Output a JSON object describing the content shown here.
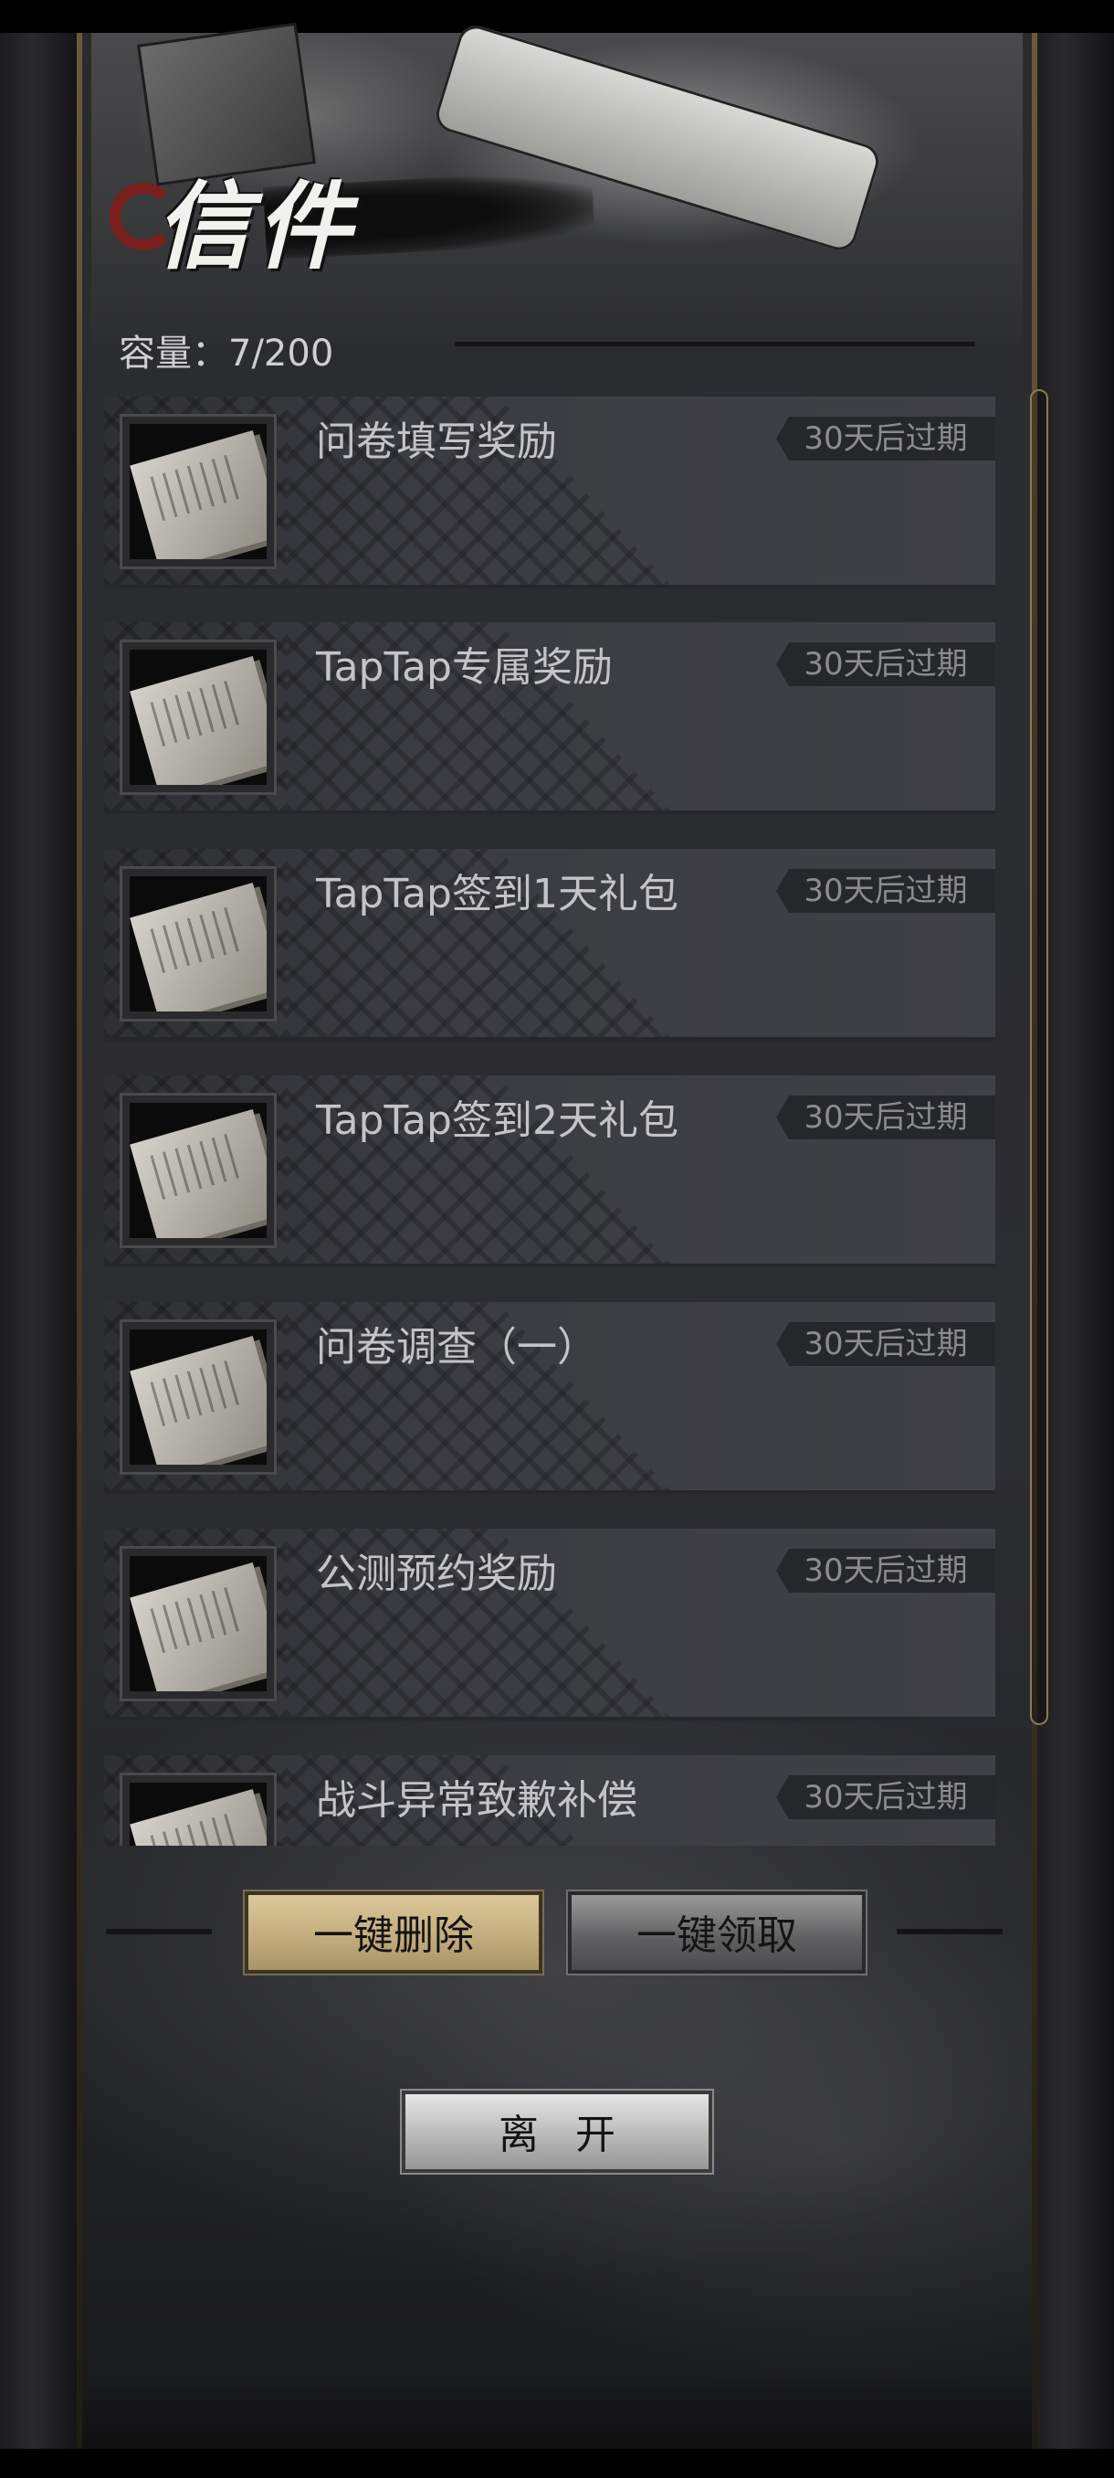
{
  "header": {
    "title": "信件",
    "capacity_label": "容量：",
    "capacity_value": "7/200"
  },
  "mail_list": [
    {
      "title": "问卷填写奖励",
      "expire": "30天后过期"
    },
    {
      "title": "TapTap专属奖励",
      "expire": "30天后过期"
    },
    {
      "title": "TapTap签到1天礼包",
      "expire": "30天后过期"
    },
    {
      "title": "TapTap签到2天礼包",
      "expire": "30天后过期"
    },
    {
      "title": "问卷调查（一）",
      "expire": "30天后过期"
    },
    {
      "title": "公测预约奖励",
      "expire": "30天后过期"
    },
    {
      "title": "战斗异常致歉补偿",
      "expire": "30天后过期"
    }
  ],
  "actions": {
    "delete_all_label": "一键删除",
    "claim_all_label": "一键领取",
    "leave_label": "离开"
  },
  "colors": {
    "seal_red": "#7a1f1c",
    "delete_button_gold": "#c3ad7e",
    "claim_button_gray": "#5e5e60",
    "item_background": "#3b3c41",
    "expire_tag_text": "#8c8c8e"
  },
  "icons": {
    "mail_thumbnail": "letter-paper-icon",
    "title_seal": "red-seal-brush-icon"
  }
}
